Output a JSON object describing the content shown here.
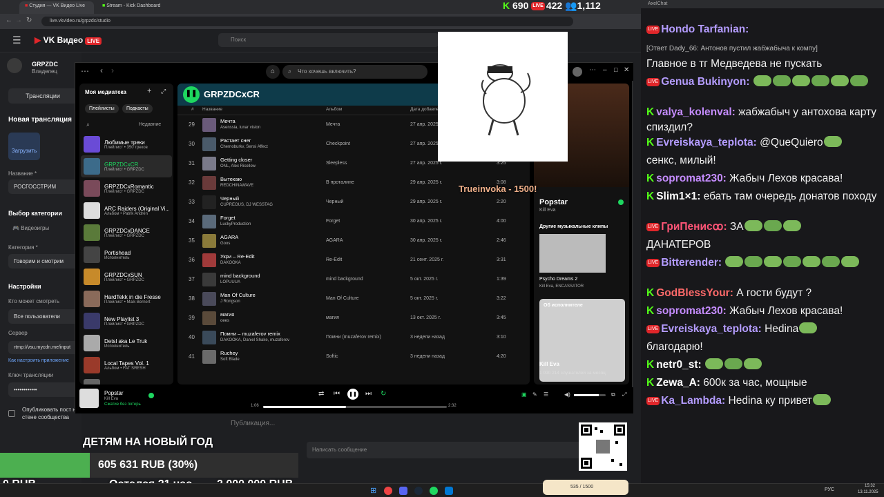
{
  "browser": {
    "tabs": [
      "Студия — VK Видео Live",
      "Stream - Kick Dashboard"
    ],
    "url": "live.vkvideo.ru/grpzdc/studio"
  },
  "vk": {
    "logo": "VK Видео",
    "live_badge": "LIVE",
    "search_placeholder": "Поиск",
    "channel": "GRPZDC",
    "role": "Владелец",
    "tab_streams": "Трансляции",
    "new_stream": "Новая трансляция",
    "upload": "Загрузить",
    "name_label": "Название *",
    "name_value": "РОСГОССТРИМ",
    "category_section": "Выбор категории",
    "videogames": "Видеоигры",
    "category_label": "Категория *",
    "category_value": "Говорим и смотрим",
    "settings": "Настройки",
    "who_label": "Кто может смотреть",
    "who_value": "Все пользователи",
    "server_label": "Сервер",
    "server_value": "rtmp://vsu.mycdn.me/input",
    "setup_link": "Как настроить приложение",
    "key_label": "Ключ трансляции",
    "key_value": "••••••••••••",
    "publish_label": "Опубликовать пост на стене сообщества ВКонтакте",
    "publish_placeholder": "Публикация...",
    "message_placeholder": "Написать сообщение"
  },
  "kick_stats": {
    "followers": "690",
    "viewers": "422",
    "subs": "1,112"
  },
  "spotify": {
    "search_placeholder": "Что хочешь включить?",
    "library_title": "Моя медиатека",
    "filter_playlists": "Плейлисты",
    "filter_podcasts": "Подкасты",
    "sort": "Недавние",
    "library": [
      {
        "name": "Любимые треки",
        "sub": "Плейлист • 350 треков",
        "color": "#6a4bd6"
      },
      {
        "name": "GRPZDCxCR",
        "sub": "Плейлист • GRPZDC",
        "color": "#3c6b8a",
        "selected": true
      },
      {
        "name": "GRPZDCxRomantic",
        "sub": "Плейлист • GRPZDC",
        "color": "#7a4a5a"
      },
      {
        "name": "ARC Raiders (Original Vi...",
        "sub": "Альбом • Patrik Andrén",
        "color": "#ddd"
      },
      {
        "name": "GRPZDCxDANCE",
        "sub": "Плейлист • GRPZDC",
        "color": "#5a7a3a"
      },
      {
        "name": "Portishead",
        "sub": "Исполнитель",
        "color": "#444"
      },
      {
        "name": "GRPZDCxSUN",
        "sub": "Плейлист • GRPZDC",
        "color": "#c78a2a"
      },
      {
        "name": "HardTekk in die Fresse",
        "sub": "Плейлист • Maik Bernert",
        "color": "#8a6a5a"
      },
      {
        "name": "New Playlist 3",
        "sub": "Плейлист • GRPZDC",
        "color": "#3a3a6a"
      },
      {
        "name": "Detsl aka Le Truk",
        "sub": "Исполнитель",
        "color": "#aaa"
      },
      {
        "name": "Local Tapes Vol. 1",
        "sub": "Альбом • FAT SRESH",
        "color": "#9a3a2a"
      },
      {
        "name": "Adele",
        "sub": "",
        "color": "#666"
      }
    ],
    "playlist_title": "GRPZDCxCR",
    "columns": {
      "num": "#",
      "title": "Название",
      "album": "Альбом",
      "date": "Дата добавления"
    },
    "rows": [
      {
        "n": "29",
        "title": "Мечта",
        "artist": "Asenssia, lunar vision",
        "album": "Мечта",
        "date": "27 апр. 2025 г.",
        "dur": "",
        "color": "#6a5a7a"
      },
      {
        "n": "30",
        "title": "Растает снег",
        "artist": "Chernoburkv, Sensi Affect",
        "album": "Checkpoint",
        "date": "27 апр. 2025 г.",
        "dur": "",
        "color": "#4a5a6a"
      },
      {
        "n": "31",
        "title": "Getting closer",
        "artist": "ONL, Alex Ricellow",
        "album": "Sleepless",
        "date": "27 апр. 2025 г.",
        "dur": "3:25",
        "color": "#7a7a8a"
      },
      {
        "n": "32",
        "title": "Вытекаю",
        "artist": "REDCHINAWAVE",
        "album": "В проталине",
        "date": "29 апр. 2025 г.",
        "dur": "3:08",
        "color": "#6a3a3a"
      },
      {
        "n": "33",
        "title": "Черный",
        "artist": "CUPREOUS, DJ WESSTAG",
        "album": "Черный",
        "date": "29 апр. 2025 г.",
        "dur": "2:20",
        "color": "#222"
      },
      {
        "n": "34",
        "title": "Forget",
        "artist": "LuckyProduction",
        "album": "Forget",
        "date": "30 апр. 2025 г.",
        "dur": "4:00",
        "color": "#5a6a7a"
      },
      {
        "n": "35",
        "title": "AGARA",
        "artist": "Goos",
        "album": "AGARA",
        "date": "30 апр. 2025 г.",
        "dur": "2:46",
        "color": "#8a7a3a"
      },
      {
        "n": "36",
        "title": "Укри – Re-Edit",
        "artist": "DAKOOKA",
        "album": "Re-Edit",
        "date": "21 сент. 2025 г.",
        "dur": "3:31",
        "color": "#a03a3a"
      },
      {
        "n": "37",
        "title": "mind background",
        "artist": "LOPUUUA",
        "album": "mind background",
        "date": "5 окт. 2025 г.",
        "dur": "1:39",
        "color": "#3a3a3a"
      },
      {
        "n": "38",
        "title": "Man Of Culture",
        "artist": "J Rongson",
        "album": "Man Of Culture",
        "date": "5 окт. 2025 г.",
        "dur": "3:22",
        "color": "#4a4a5a"
      },
      {
        "n": "39",
        "title": "магия",
        "artist": "oees",
        "album": "магия",
        "date": "13 окт. 2025 г.",
        "dur": "3:45",
        "color": "#5a4a3a"
      },
      {
        "n": "40",
        "title": "Помни – muzaferov remix",
        "artist": "DAKOOKA, Daniel Shake, muzaferov",
        "album": "Помни (muzaferov remix)",
        "date": "3 недели назад",
        "dur": "3:10",
        "color": "#3a4a5a"
      },
      {
        "n": "41",
        "title": "Ruchey",
        "artist": "Soft Blade",
        "album": "Softic",
        "date": "3 недели назад",
        "dur": "4:20",
        "color": "#6a6a6a"
      }
    ],
    "now": {
      "title": "Popstar",
      "artist": "Kill Eva",
      "other_clips": "Другие музыкальные клипы",
      "clip": "Psycho Dreams 2",
      "clip_artists": "Kill Eva, ENCASSATOR",
      "about": "Об исполнителе",
      "listeners": "1 090 214 слушателей за месяц"
    },
    "player": {
      "title": "Popstar",
      "artist": "Kill Eva",
      "saved": "Сжатие без потерь",
      "elapsed": "1:06",
      "total": "2:32",
      "progress": 0.45
    }
  },
  "overlay": {
    "donation_alert": "Trueinvoka - 1500!"
  },
  "goal": {
    "title": "ДЕТЯМ НА НОВЫЙ ГОД",
    "raised": "605 631 RUB (30%)",
    "start": "0 RUB",
    "time_left": "Остался 21 час",
    "target": "2 000 000 RUB",
    "progress": 0.3
  },
  "chat": {
    "app": "AxelChat",
    "messages": [
      {
        "src": "live",
        "user": "Hondo Tarfanian:",
        "ucolor": "#b49cff",
        "text": ""
      },
      {
        "src": "",
        "user": "",
        "ucolor": "#aaa",
        "text": "[Ответ Dady_66: Антонов пустил жабжабыча к компу]"
      },
      {
        "src": "",
        "user": "",
        "ucolor": "#fff",
        "text": "Главное в тг Медведева не пускать"
      },
      {
        "src": "live",
        "user": "Genua Bukinyon:",
        "ucolor": "#b49cff",
        "text": ""
      },
      {
        "src": "kick",
        "user": "valya_kolenval:",
        "ucolor": "#c58cff",
        "text": "жабжабыч у антохова карту спиздил?"
      },
      {
        "src": "kick",
        "user": "Evreiskaya_teplota:",
        "ucolor": "#b49cff",
        "text": "@QueQuiero"
      },
      {
        "src": "",
        "user": "",
        "ucolor": "#fff",
        "text": "сенкс, милый!"
      },
      {
        "src": "kick",
        "user": "sopromat230:",
        "ucolor": "#c58cff",
        "text": "Жабыч Лехов красава!"
      },
      {
        "src": "kick",
        "user": "Slim1×1:",
        "ucolor": "#ffffff",
        "text": "ебать там очередь донатов походу"
      },
      {
        "src": "live",
        "user": "ГриПенисꝏ:",
        "ucolor": "#ff5577",
        "text": "ЗА"
      },
      {
        "src": "",
        "user": "",
        "ucolor": "#fff",
        "text": "ДАНАТЕРОВ"
      },
      {
        "src": "live",
        "user": "Bitterender:",
        "ucolor": "#b49cff",
        "text": ""
      },
      {
        "src": "kick",
        "user": "GodBlessYour:",
        "ucolor": "#ff6a6a",
        "text": "А гости будут ?"
      },
      {
        "src": "kick",
        "user": "sopromat230:",
        "ucolor": "#c58cff",
        "text": "Жабыч Лехов красава!"
      },
      {
        "src": "live",
        "user": "Evreiskaya_teplota:",
        "ucolor": "#b49cff",
        "text": "Hedina"
      },
      {
        "src": "",
        "user": "",
        "ucolor": "#fff",
        "text": "благодарю!"
      },
      {
        "src": "kick",
        "user": "netr0_st:",
        "ucolor": "#ffffff",
        "text": ""
      },
      {
        "src": "kick",
        "user": "Zewa_A:",
        "ucolor": "#ffffff",
        "text": "600к за час, мощные"
      },
      {
        "src": "live",
        "user": "Ka_Lambda:",
        "ucolor": "#b49cff",
        "text": "Hedina ку привет"
      }
    ]
  },
  "taskbar": {
    "lang": "РУС",
    "time": "15:32",
    "date": "13.11.2025",
    "widget": "535 / 1500"
  }
}
